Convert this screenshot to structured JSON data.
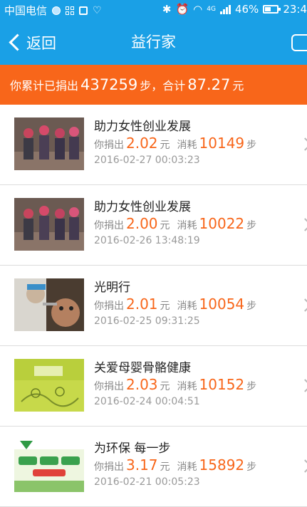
{
  "status_bar": {
    "carrier": "中国电信",
    "network": "4G",
    "battery": "46%",
    "time": "23:4"
  },
  "header": {
    "back_label": "返回",
    "title": "益行家"
  },
  "summary": {
    "prefix": "你累计已捐出",
    "steps": "437259",
    "steps_unit": "步，合计",
    "amount": "87.27",
    "amount_unit": "元"
  },
  "labels": {
    "donated": "你捐出",
    "yuan": "元",
    "consumed": "消耗",
    "steps": "步"
  },
  "items": [
    {
      "title": "助力女性创业发展",
      "amount": "2.02",
      "steps": "10149",
      "date": "2016-02-27 00:03:23",
      "thumb": "women-group-photo"
    },
    {
      "title": "助力女性创业发展",
      "amount": "2.00",
      "steps": "10022",
      "date": "2016-02-26 13:48:19",
      "thumb": "women-group-photo"
    },
    {
      "title": "光明行",
      "amount": "2.01",
      "steps": "10054",
      "date": "2016-02-25 09:31:25",
      "thumb": "eye-exam-photo"
    },
    {
      "title": "关爱母婴骨骼健康",
      "amount": "2.03",
      "steps": "10152",
      "date": "2016-02-24 00:04:51",
      "thumb": "green-illustration"
    },
    {
      "title": "为环保 每一步",
      "amount": "3.17",
      "steps": "15892",
      "date": "2016-02-21 00:05:23",
      "thumb": "eco-poster"
    }
  ],
  "colors": {
    "header_blue": "#1aa0e6",
    "accent_orange": "#f8661a"
  }
}
